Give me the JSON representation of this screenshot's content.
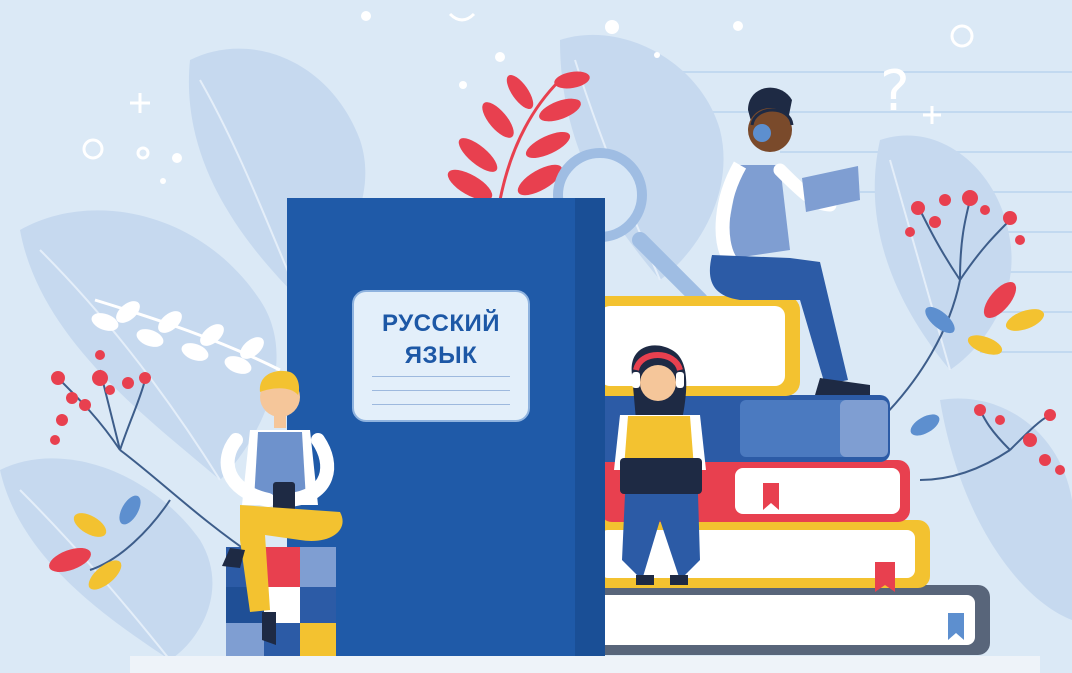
{
  "book": {
    "title_line1": "РУССКИЙ",
    "title_line2": "ЯЗЫК"
  },
  "colors": {
    "background": "#dbe9f6",
    "book_blue": "#1f5aa8",
    "accent_red": "#e8404f",
    "accent_yellow": "#f3c230",
    "leaf_light": "#c6d9ef"
  }
}
